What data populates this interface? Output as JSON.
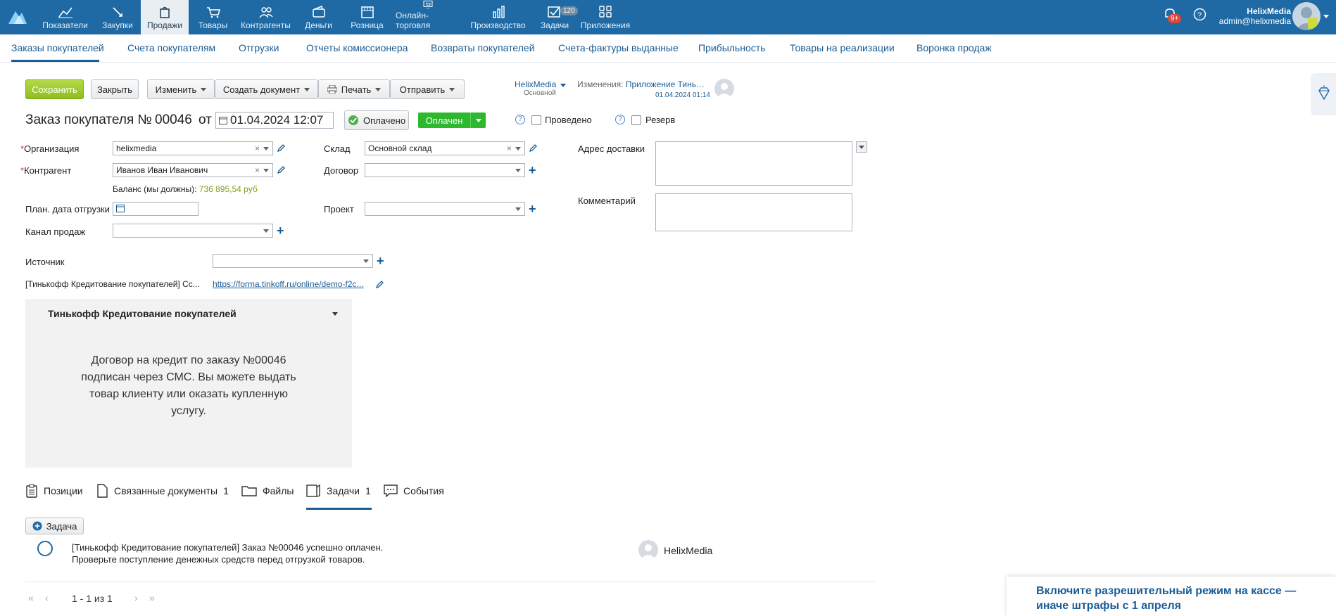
{
  "topnav": {
    "items": [
      {
        "label": "Показатели",
        "icon": "chart-line-icon"
      },
      {
        "label": "Закупки",
        "icon": "bag-arrow-icon"
      },
      {
        "label": "Продажи",
        "icon": "shopping-bag-icon"
      },
      {
        "label": "Товары",
        "icon": "cart-icon"
      },
      {
        "label": "Контрагенты",
        "icon": "people-icon"
      },
      {
        "label": "Деньги",
        "icon": "wallet-icon"
      },
      {
        "label": "Розница",
        "icon": "store-icon"
      },
      {
        "label": "Онлайн-торговля",
        "icon": "online-store-icon"
      },
      {
        "label": "Производство",
        "icon": "factory-icon"
      },
      {
        "label": "Задачи",
        "icon": "tasks-check-icon"
      },
      {
        "label": "Приложения",
        "icon": "apps-grid-icon"
      }
    ],
    "tasks_badge": "120",
    "notifications_badge": "9+",
    "user_name": "HelixMedia",
    "user_email": "admin@helixmedia"
  },
  "subnav": {
    "items": [
      "Заказы покупателей",
      "Счета покупателям",
      "Отгрузки",
      "Отчеты комиссионера",
      "Возвраты покупателей",
      "Счета-фактуры выданные",
      "Прибыльность",
      "Товары на реализации",
      "Воронка продаж"
    ]
  },
  "toolbar": {
    "save": "Сохранить",
    "close": "Закрыть",
    "edit": "Изменить",
    "create_doc": "Создать документ",
    "print": "Печать",
    "send": "Отправить",
    "owner": "HelixMedia",
    "owner_sub": "Основной",
    "changes_label": "Изменения:",
    "changes_value": "Приложение Тинь…",
    "changes_date": "01.04.2024 01:14"
  },
  "header": {
    "title": "Заказ покупателя №",
    "number": "00046",
    "from": "от",
    "date": "01.04.2024 12:07",
    "paid_btn": "Оплачено",
    "status": "Оплачен",
    "posted": "Проведено",
    "reserve": "Резерв"
  },
  "form": {
    "org_label": "Организация",
    "org_value": "helixmedia",
    "contractor_label": "Контрагент",
    "contractor_value": "Иванов Иван Иванович",
    "balance_label": "Баланс (мы должны):",
    "balance_value": "736 895,54 руб",
    "ship_date_label": "План. дата отгрузки",
    "channel_label": "Канал продаж",
    "warehouse_label": "Склад",
    "warehouse_value": "Основной склад",
    "contract_label": "Договор",
    "project_label": "Проект",
    "address_label": "Адрес доставки",
    "comment_label": "Комментарий",
    "source_label": "Источник",
    "tinkoff_link_label": "[Тинькофф Кредитование покупателей] Сс...",
    "tinkoff_link": "https://forma.tinkoff.ru/online/demo-f2c..."
  },
  "tinkoff_panel": {
    "title": "Тинькофф Кредитование покупателей",
    "text": "Договор на кредит по заказу №00046 подписан через СМС. Вы можете выдать товар клиенту или оказать купленную услугу."
  },
  "tabs": [
    {
      "label": "Позиции",
      "count": ""
    },
    {
      "label": "Связанные документы",
      "count": "1"
    },
    {
      "label": "Файлы",
      "count": ""
    },
    {
      "label": "Задачи",
      "count": "1"
    },
    {
      "label": "События",
      "count": ""
    }
  ],
  "tasks": {
    "add_button": "Задача",
    "row_text": "[Тинькофф Кредитование покупателей] Заказ №00046 успешно оплачен. Проверьте поступление денежных средств перед отгрузкой товаров.",
    "assignee": "HelixMedia",
    "pager": "1 - 1 из 1"
  },
  "promo": {
    "text": "Включите разрешительный режим на кассе — иначе штрафы с 1 апреля"
  },
  "colors": {
    "topbar": "#1f6aa5",
    "accent": "#1a5c95",
    "green": "#8cbf1e",
    "status_green": "#2eb82e"
  }
}
